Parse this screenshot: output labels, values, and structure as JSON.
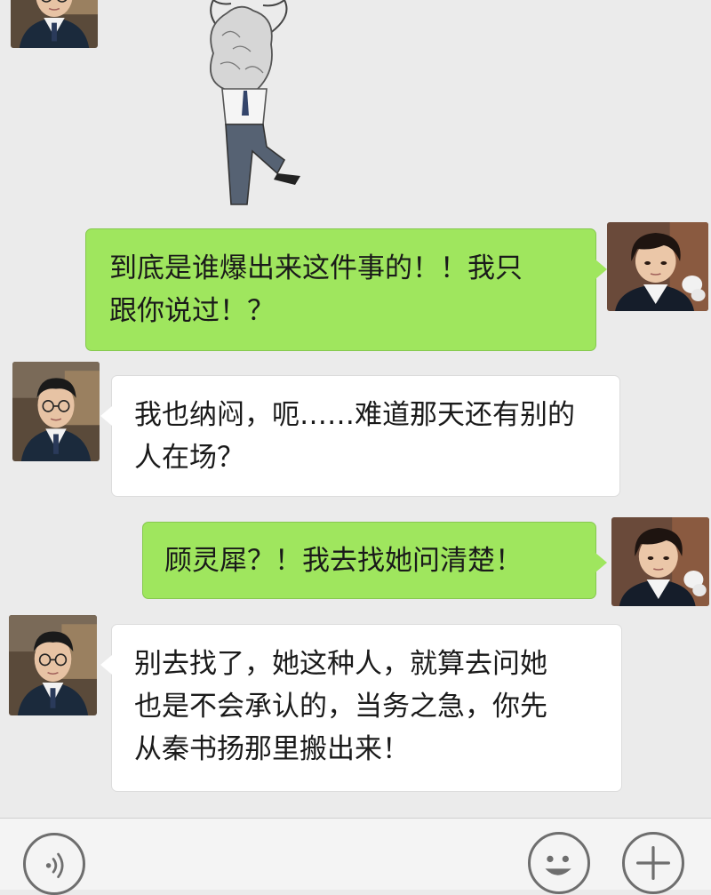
{
  "chat": {
    "messages": [
      {
        "side": "in",
        "sender": "friend",
        "type": "sticker"
      },
      {
        "side": "out",
        "sender": "me",
        "type": "text",
        "lines": [
          "到底是谁爆出来这件事的！！我只",
          "跟你说过！？"
        ]
      },
      {
        "side": "in",
        "sender": "friend",
        "type": "text",
        "lines": [
          "我也纳闷，呃……难道那天还有别的",
          "人在场？"
        ]
      },
      {
        "side": "out",
        "sender": "me",
        "type": "text",
        "lines": [
          "顾灵犀？！我去找她问清楚！"
        ]
      },
      {
        "side": "in",
        "sender": "friend",
        "type": "text",
        "lines": [
          "别去找了，她这种人，就算去问她",
          "也是不会承认的，当务之急，你先",
          "从秦书扬那里搬出来！"
        ]
      }
    ]
  },
  "input_bar": {
    "left_icon": "voice-icon",
    "right_icons": [
      "emoji-icon",
      "plus-icon"
    ]
  },
  "colors": {
    "background": "#ebebeb",
    "outgoing_bubble": "#9fe65e",
    "incoming_bubble": "#ffffff"
  }
}
